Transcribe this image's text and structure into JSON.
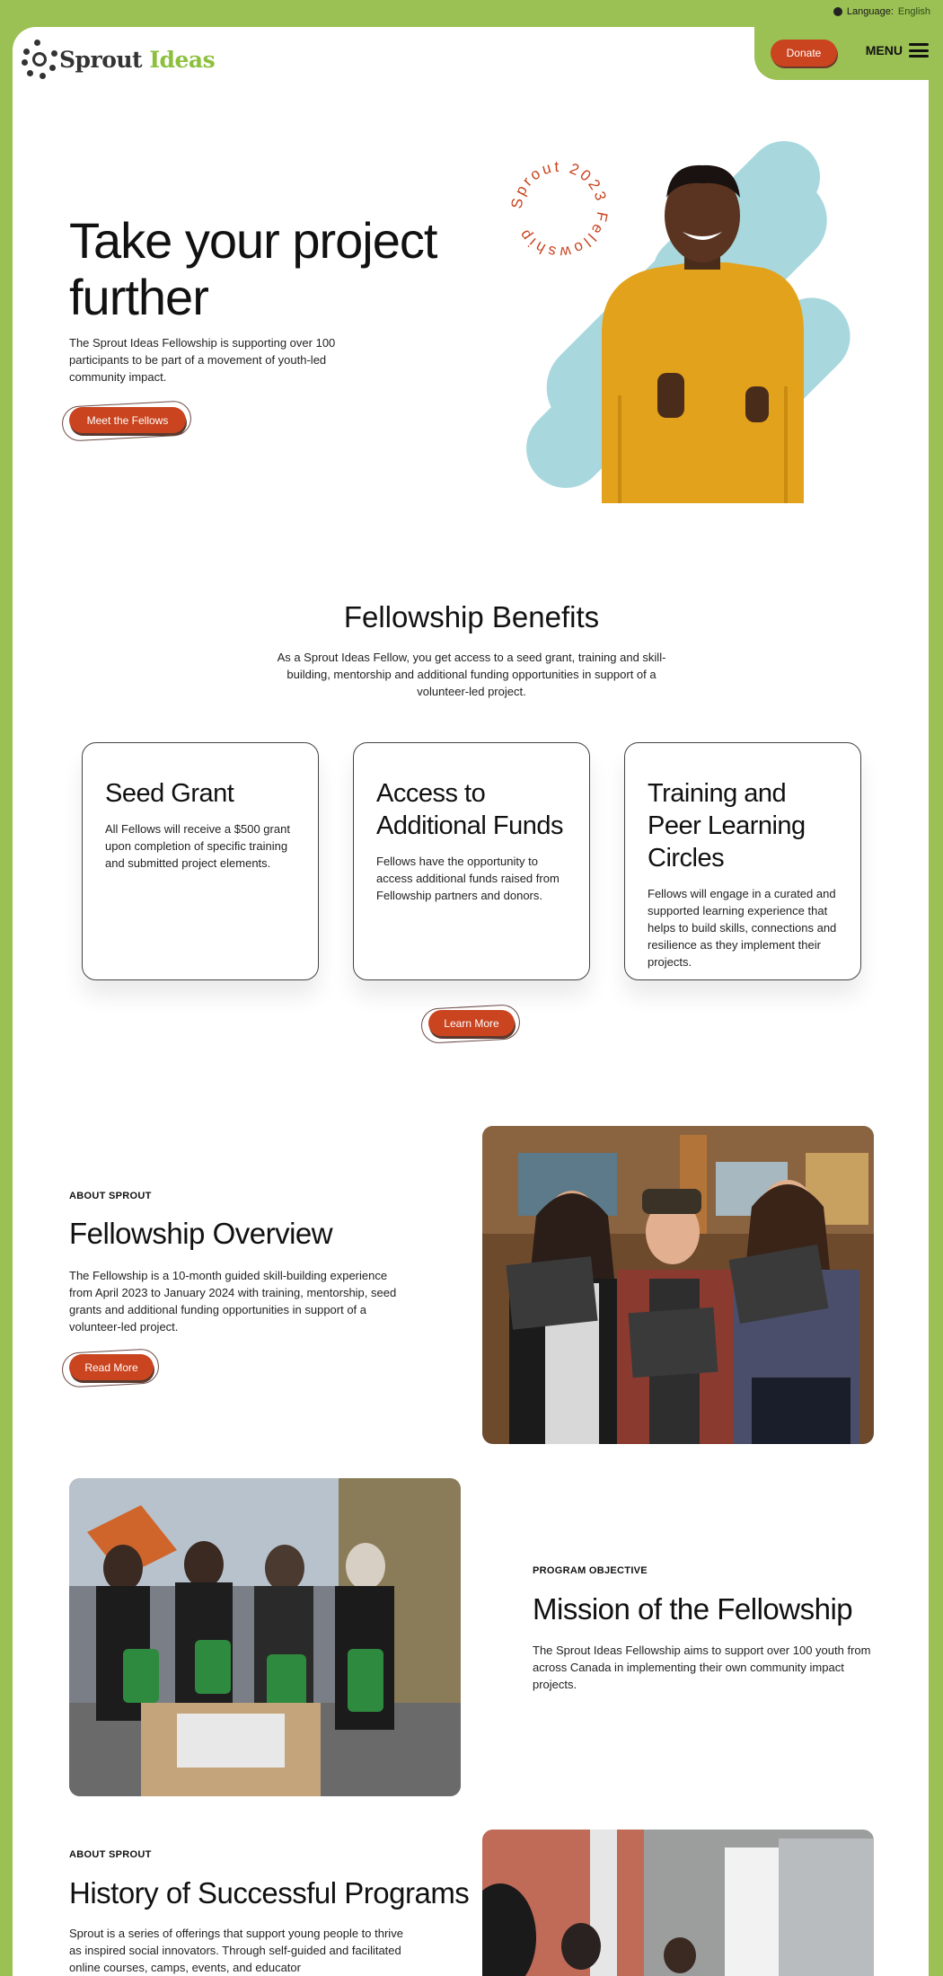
{
  "language": {
    "label": "Language:",
    "value": "English"
  },
  "header": {
    "logo_word1": "Sprout",
    "logo_word2": "Ideas",
    "donate_label": "Donate",
    "menu_label": "MENU"
  },
  "hero": {
    "title": "Take your project further",
    "text": "The Sprout Ideas Fellowship is supporting over 100 participants to be part of a movement of youth-led community impact.",
    "cta_label": "Meet the Fellows",
    "badge_text": "Sprout 2023 Fellowship"
  },
  "benefits": {
    "title": "Fellowship Benefits",
    "subtitle": "As a Sprout Ideas Fellow, you get access to a seed grant, training and skill-building, mentorship and additional funding opportunities in support of a volunteer-led project.",
    "cards": [
      {
        "title": "Seed Grant",
        "text": "All Fellows will receive a $500 grant upon completion of specific training and submitted project elements."
      },
      {
        "title": "Access to Additional Funds",
        "text": "Fellows have the opportunity to access additional funds raised from Fellowship partners and donors."
      },
      {
        "title": "Training and Peer Learning Circles",
        "text": "Fellows will engage in a curated and supported learning experience that helps to build skills, connections and resilience as they implement their projects."
      }
    ],
    "cta_label": "Learn More"
  },
  "overview": {
    "eyebrow": "ABOUT SPROUT",
    "title": "Fellowship Overview",
    "text": "The Fellowship is a 10-month guided skill-building experience from April 2023 to January 2024 with training, mentorship, seed grants and additional funding opportunities in support of a volunteer-led project.",
    "cta_label": "Read More"
  },
  "mission": {
    "eyebrow": "PROGRAM OBJECTIVE",
    "title": "Mission of the Fellowship",
    "text": "The Sprout Ideas Fellowship aims to support over 100 youth from across Canada in implementing their own community impact projects."
  },
  "history": {
    "eyebrow": "ABOUT SPROUT",
    "title": "History of Successful Programs",
    "text": "Sprout is a series of offerings that support young people to thrive as inspired social innovators. Through self-guided and facilitated online courses, camps, events, and educator"
  },
  "colors": {
    "brand_green": "#9bc053",
    "accent_orange": "#c9441f",
    "hero_blue": "#a8d8de",
    "shirt_yellow": "#e3a21b"
  }
}
